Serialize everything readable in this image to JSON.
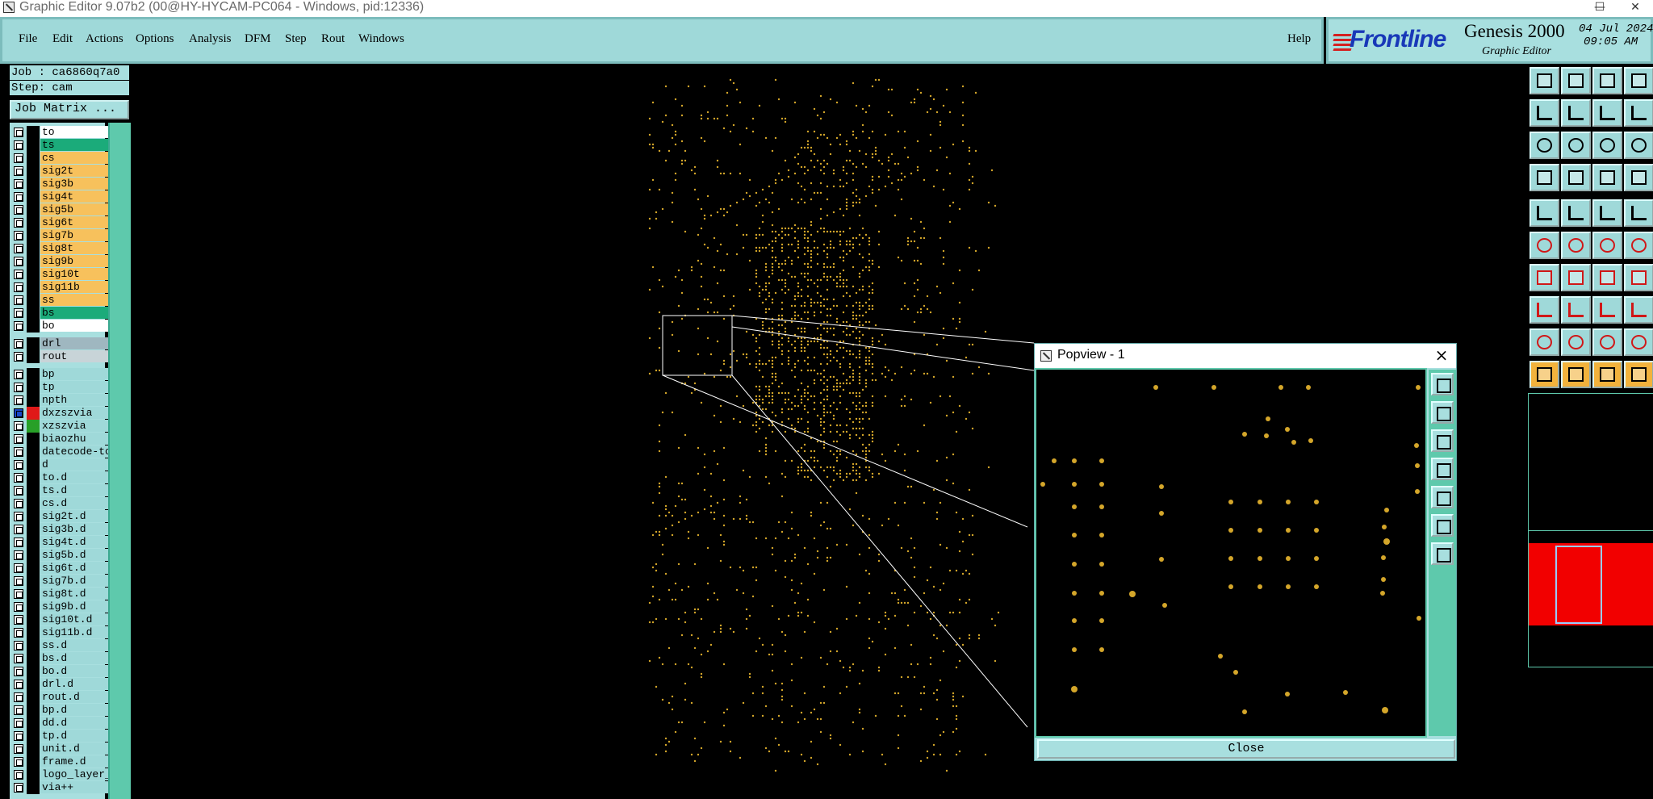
{
  "window": {
    "title": "Graphic Editor 9.07b2 (00@HY-HYCAM-PC064 - Windows, pid:12336)",
    "minimize": "—",
    "maximize": "☐",
    "close": "✕"
  },
  "menu": {
    "items": [
      "File",
      "Edit",
      "Actions",
      "Options",
      "Analysis",
      "DFM",
      "Step",
      "Rout",
      "Windows"
    ],
    "underline": [
      "F",
      "E",
      "A",
      "O",
      "A",
      "D",
      "S",
      "R",
      "W"
    ],
    "help": "Help"
  },
  "branding": {
    "logo": "Frontline",
    "product": "Genesis 2000",
    "subtitle": "Graphic Editor",
    "date": "04 Jul 2024",
    "time": "09:05 AM"
  },
  "job": {
    "job_line": "Job : ca6860q7a0",
    "step_line": "Step: cam",
    "matrix_button": "Job Matrix ..."
  },
  "layers": [
    {
      "name": "to",
      "color": "#ffffff"
    },
    {
      "name": "ts",
      "color": "#1bab7a"
    },
    {
      "name": "cs",
      "color": "#f7c15c"
    },
    {
      "name": "sig2t",
      "color": "#f7c15c"
    },
    {
      "name": "sig3b",
      "color": "#f7c15c"
    },
    {
      "name": "sig4t",
      "color": "#f7c15c"
    },
    {
      "name": "sig5b",
      "color": "#f7c15c"
    },
    {
      "name": "sig6t",
      "color": "#f7c15c"
    },
    {
      "name": "sig7b",
      "color": "#f7c15c"
    },
    {
      "name": "sig8t",
      "color": "#f7c15c"
    },
    {
      "name": "sig9b",
      "color": "#f7c15c"
    },
    {
      "name": "sig10t",
      "color": "#f7c15c"
    },
    {
      "name": "sig11b",
      "color": "#f7c15c"
    },
    {
      "name": "ss",
      "color": "#f7c15c"
    },
    {
      "name": "bs",
      "color": "#1bab7a"
    },
    {
      "name": "bo",
      "color": "#ffffff"
    },
    {
      "name": "drl",
      "color": "#9fb7c0",
      "gap": true
    },
    {
      "name": "rout",
      "color": "#c8d4d8"
    },
    {
      "name": "bp",
      "color": "#9fd9d9",
      "gap": true
    },
    {
      "name": "tp",
      "color": "#9fd9d9"
    },
    {
      "name": "npth",
      "color": "#9fd9d9"
    },
    {
      "name": "dxzszvia",
      "color": "#9fd9d9",
      "active": true,
      "swatch": "#e01818"
    },
    {
      "name": "xzszvia",
      "color": "#9fd9d9",
      "swatch": "#28a028"
    },
    {
      "name": "biaozhu",
      "color": "#9fd9d9"
    },
    {
      "name": "datecode-to",
      "color": "#9fd9d9"
    },
    {
      "name": "d",
      "color": "#9fd9d9"
    },
    {
      "name": "to.d",
      "color": "#9fd9d9"
    },
    {
      "name": "ts.d",
      "color": "#9fd9d9"
    },
    {
      "name": "cs.d",
      "color": "#9fd9d9"
    },
    {
      "name": "sig2t.d",
      "color": "#9fd9d9"
    },
    {
      "name": "sig3b.d",
      "color": "#9fd9d9"
    },
    {
      "name": "sig4t.d",
      "color": "#9fd9d9"
    },
    {
      "name": "sig5b.d",
      "color": "#9fd9d9"
    },
    {
      "name": "sig6t.d",
      "color": "#9fd9d9"
    },
    {
      "name": "sig7b.d",
      "color": "#9fd9d9"
    },
    {
      "name": "sig8t.d",
      "color": "#9fd9d9"
    },
    {
      "name": "sig9b.d",
      "color": "#9fd9d9"
    },
    {
      "name": "sig10t.d",
      "color": "#9fd9d9"
    },
    {
      "name": "sig11b.d",
      "color": "#9fd9d9"
    },
    {
      "name": "ss.d",
      "color": "#9fd9d9"
    },
    {
      "name": "bs.d",
      "color": "#9fd9d9"
    },
    {
      "name": "bo.d",
      "color": "#9fd9d9"
    },
    {
      "name": "drl.d",
      "color": "#9fd9d9"
    },
    {
      "name": "rout.d",
      "color": "#9fd9d9"
    },
    {
      "name": "bp.d",
      "color": "#9fd9d9"
    },
    {
      "name": "dd.d",
      "color": "#9fd9d9"
    },
    {
      "name": "tp.d",
      "color": "#9fd9d9"
    },
    {
      "name": "unit.d",
      "color": "#9fd9d9"
    },
    {
      "name": "frame.d",
      "color": "#9fd9d9"
    },
    {
      "name": "logo_layer_",
      "color": "#9fd9d9"
    },
    {
      "name": "via++",
      "color": "#9fd9d9"
    }
  ],
  "popview": {
    "title": "Popview - 1",
    "close_x": "×",
    "close_button": "Close"
  },
  "colors": {
    "background": "#000000",
    "pad": "#d4a62a",
    "panel": "#a8dfdf",
    "accent": "#5ec9ac"
  }
}
